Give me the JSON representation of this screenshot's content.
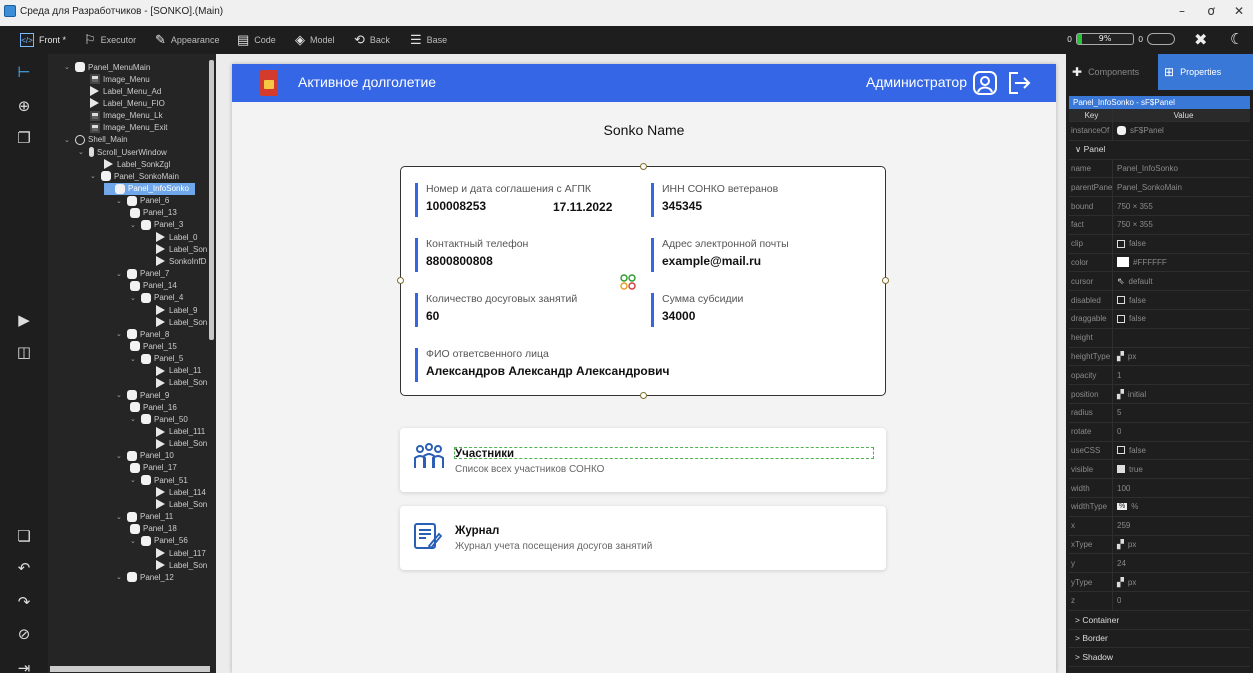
{
  "window": {
    "title": "Среда для Разработчиков - [SONKO].(Main)",
    "min": "–",
    "max": "ơ",
    "close": "✕"
  },
  "toolbar": {
    "items": [
      {
        "label": "Front *",
        "icon": "front-icon"
      },
      {
        "label": "Executor",
        "icon": "executor-icon"
      },
      {
        "label": "Appearance",
        "icon": "appearance-icon"
      },
      {
        "label": "Code",
        "icon": "code-icon"
      },
      {
        "label": "Model",
        "icon": "model-icon"
      },
      {
        "label": "Back",
        "icon": "back-icon"
      },
      {
        "label": "Base",
        "icon": "base-icon"
      }
    ],
    "progress_left": "0",
    "progress_pct": "9%",
    "progress_value": 0.09,
    "progress2_left": "0"
  },
  "tree": [
    {
      "label": "Panel_MenuMain",
      "icon": "panel",
      "chev": "⌄"
    },
    {
      "label": "Image_Menu",
      "icon": "img"
    },
    {
      "label": "Label_Menu_Ad",
      "icon": "label"
    },
    {
      "label": "Label_Menu_FIO",
      "icon": "label"
    },
    {
      "label": "Image_Menu_Lk",
      "icon": "img"
    },
    {
      "label": "Image_Menu_Exit",
      "icon": "img"
    },
    {
      "label": "Shell_Main",
      "icon": "shell",
      "chev": "⌄"
    },
    {
      "label": "Scroll_UserWindow",
      "icon": "scroll",
      "chev": "⌄"
    },
    {
      "label": "Label_SonkZgl",
      "icon": "label"
    },
    {
      "label": "Panel_SonkoMain",
      "icon": "panel",
      "chev": "⌄"
    },
    {
      "label": "Panel_InfoSonko",
      "icon": "panel",
      "chev": "⌄",
      "selected": true
    },
    {
      "label": "Panel_6",
      "icon": "panel",
      "chev": "⌄"
    },
    {
      "label": "Panel_13",
      "icon": "panel"
    },
    {
      "label": "Panel_3",
      "icon": "panel",
      "chev": "⌄"
    },
    {
      "label": "Label_0",
      "icon": "label"
    },
    {
      "label": "Label_Son",
      "icon": "label"
    },
    {
      "label": "SonkoInfD",
      "icon": "label"
    },
    {
      "label": "Panel_7",
      "icon": "panel",
      "chev": "⌄"
    },
    {
      "label": "Panel_14",
      "icon": "panel"
    },
    {
      "label": "Panel_4",
      "icon": "panel",
      "chev": "⌄"
    },
    {
      "label": "Label_9",
      "icon": "label"
    },
    {
      "label": "Label_Son",
      "icon": "label"
    },
    {
      "label": "Panel_8",
      "icon": "panel",
      "chev": "⌄"
    },
    {
      "label": "Panel_15",
      "icon": "panel"
    },
    {
      "label": "Panel_5",
      "icon": "panel",
      "chev": "⌄"
    },
    {
      "label": "Label_11",
      "icon": "label"
    },
    {
      "label": "Label_Son",
      "icon": "label"
    },
    {
      "label": "Panel_9",
      "icon": "panel",
      "chev": "⌄"
    },
    {
      "label": "Panel_16",
      "icon": "panel"
    },
    {
      "label": "Panel_50",
      "icon": "panel",
      "chev": "⌄"
    },
    {
      "label": "Label_111",
      "icon": "label"
    },
    {
      "label": "Label_Son",
      "icon": "label"
    },
    {
      "label": "Panel_10",
      "icon": "panel",
      "chev": "⌄"
    },
    {
      "label": "Panel_17",
      "icon": "panel"
    },
    {
      "label": "Panel_51",
      "icon": "panel",
      "chev": "⌄"
    },
    {
      "label": "Label_114",
      "icon": "label"
    },
    {
      "label": "Label_Son",
      "icon": "label"
    },
    {
      "label": "Panel_11",
      "icon": "panel",
      "chev": "⌄"
    },
    {
      "label": "Panel_18",
      "icon": "panel"
    },
    {
      "label": "Panel_56",
      "icon": "panel",
      "chev": "⌄"
    },
    {
      "label": "Label_117",
      "icon": "label"
    },
    {
      "label": "Label_Son",
      "icon": "label"
    },
    {
      "label": "Panel_12",
      "icon": "panel",
      "chev": "⌄"
    }
  ],
  "app": {
    "title": "Активное долголетие",
    "admin": "Администратор",
    "sonko_name": "Sonko Name",
    "fields": {
      "agreement_key": "Номер и дата соглашения с АГПК",
      "agreement_num": "100008253",
      "agreement_date": "17.11.2022",
      "inn_key": "ИНН СОНКО ветеранов",
      "inn_val": "345345",
      "phone_key": "Контактный телефон",
      "phone_val": "8800800808",
      "email_key": "Адрес электронной почты",
      "email_val": "example@mail.ru",
      "count_key": "Количество досуговых занятий",
      "count_val": "60",
      "subsidy_key": "Сумма субсидии",
      "subsidy_val": "34000",
      "person_key": "ФИО ответсвенного лица",
      "person_val": "Александров Александр Александрович"
    },
    "cards": [
      {
        "title": "Участники",
        "desc": "Список всех участников СОНКО"
      },
      {
        "title": "Журнал",
        "desc": "Журнал учета посещения досугов занятий"
      }
    ]
  },
  "props": {
    "tab_components": "Components",
    "tab_properties": "Properties",
    "header": "Panel_InfoSonko - sF$Panel",
    "col_key": "Key",
    "col_value": "Value",
    "rows": [
      {
        "k": "instanceOf",
        "v": "sF$Panel",
        "kind": "panel"
      },
      {
        "sec": "∨  Panel"
      },
      {
        "k": "name",
        "v": "Panel_InfoSonko"
      },
      {
        "k": "parentPane",
        "v": "Panel_SonkoMain"
      },
      {
        "k": "bound",
        "v": "750 × 355"
      },
      {
        "k": "fact",
        "v": "750 × 355"
      },
      {
        "k": "clip",
        "v": "false",
        "kind": "cb"
      },
      {
        "k": "color",
        "v": "#FFFFFF",
        "kind": "sw"
      },
      {
        "k": "cursor",
        "v": "default",
        "kind": "cursor"
      },
      {
        "k": "disabled",
        "v": "false",
        "kind": "cb"
      },
      {
        "k": "draggable",
        "v": "false",
        "kind": "cb"
      },
      {
        "k": "height",
        "v": ""
      },
      {
        "k": "heightType",
        "v": "px",
        "kind": "gr"
      },
      {
        "k": "opacity",
        "v": "1"
      },
      {
        "k": "position",
        "v": "initial",
        "kind": "gr"
      },
      {
        "k": "radius",
        "v": "5"
      },
      {
        "k": "rotate",
        "v": "0"
      },
      {
        "k": "useCSS",
        "v": "false",
        "kind": "cb"
      },
      {
        "k": "visible",
        "v": "true",
        "kind": "cbon"
      },
      {
        "k": "width",
        "v": "100"
      },
      {
        "k": "widthType",
        "v": "%",
        "kind": "pct"
      },
      {
        "k": "x",
        "v": "259"
      },
      {
        "k": "xType",
        "v": "px",
        "kind": "gr"
      },
      {
        "k": "y",
        "v": "24"
      },
      {
        "k": "yType",
        "v": "px",
        "kind": "gr"
      },
      {
        "k": "z",
        "v": "0"
      },
      {
        "sec": ">  Container"
      },
      {
        "sec": ">  Border"
      },
      {
        "sec": ">  Shadow"
      }
    ]
  }
}
